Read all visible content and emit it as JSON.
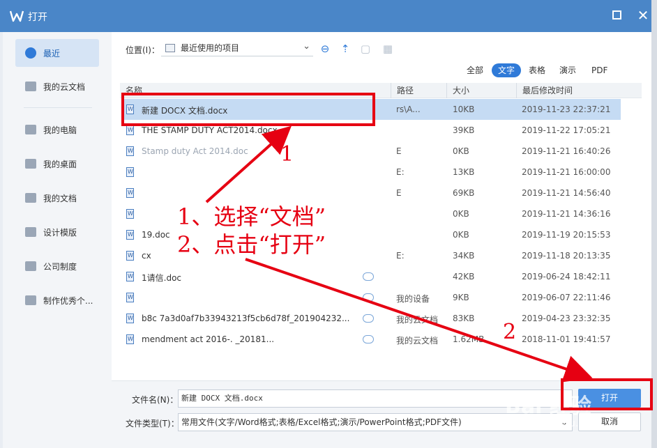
{
  "window": {
    "title": "打开"
  },
  "sidebar": {
    "items": [
      {
        "label": "最近",
        "icon": "clock-icon",
        "active": true
      },
      {
        "label": "我的云文档",
        "icon": "cloud-cube-icon"
      },
      {
        "label": "我的电脑",
        "icon": "computer-icon"
      },
      {
        "label": "我的桌面",
        "icon": "desktop-icon"
      },
      {
        "label": "我的文档",
        "icon": "folder-icon"
      },
      {
        "label": "设计模版",
        "icon": "folder-icon"
      },
      {
        "label": "公司制度",
        "icon": "folder-icon"
      },
      {
        "label": "制作优秀个...",
        "icon": "folder-icon"
      }
    ]
  },
  "toolbar": {
    "location_label": "位置(I)：",
    "location_value": "最近使用的项目"
  },
  "filters": [
    "全部",
    "文字",
    "表格",
    "演示",
    "PDF"
  ],
  "table": {
    "headers": [
      "名称",
      "路径",
      "大小",
      "最后修改时间"
    ],
    "rows": [
      {
        "name": "新建 DOCX 文档.docx",
        "path": "rs\\A...",
        "size": "10KB",
        "date": "2019-11-23 22:37:21"
      },
      {
        "name": "THE STAMP DUTY ACT2014.docx",
        "path": "",
        "size": "39KB",
        "date": "2019-11-22 17:05:21"
      },
      {
        "name": "Stamp duty Act 2014.doc",
        "path": "E",
        "size": "0KB",
        "date": "2019-11-21 16:40:26"
      },
      {
        "name": "",
        "path": "E:",
        "size": "13KB",
        "date": "2019-11-21 16:00:00"
      },
      {
        "name": "",
        "path": "E",
        "size": "69KB",
        "date": "2019-11-21 14:56:40"
      },
      {
        "name": "",
        "path": "",
        "size": "0KB",
        "date": "2019-11-21 14:36:16"
      },
      {
        "name": "19.doc",
        "path": "",
        "size": "0KB",
        "date": "2019-11-19 20:15:53"
      },
      {
        "name": "cx",
        "path": "E:",
        "size": "34KB",
        "date": "2019-11-18 20:13:35"
      },
      {
        "name": "1请信.doc",
        "path": "",
        "size": "42KB",
        "date": "2019-06-24 18:42:11"
      },
      {
        "name": "",
        "path": "我的设备",
        "size": "9KB",
        "date": "2019-06-07 22:11:46"
      },
      {
        "name": "b8c   7a3d0af7b33943213f5cb6d78f_201904232...",
        "path": "我的云文档",
        "size": "83KB",
        "date": "2019-04-23 23:32:35"
      },
      {
        "name": "mendment act 2016-.       _20181...",
        "path": "我的云文档",
        "size": "1.62MB",
        "date": "2018-11-01 19:41:57"
      }
    ]
  },
  "footer": {
    "filename_label": "文件名(N)：",
    "filename_value": "新建 DOCX 文档.docx",
    "filetype_label": "文件类型(T)：",
    "filetype_value": "常用文件(文字/Word格式;表格/Excel格式;演示/PowerPoint格式;PDF文件)",
    "open_label": "打开",
    "cancel_label": "取消"
  },
  "annotations": {
    "line1": "1、选择“文档”",
    "line2": "2、点击“打开”",
    "num1": "1",
    "num2": "2",
    "color": "#e60012"
  },
  "watermark": {
    "main": "Bai 经验",
    "sub": "jingyan.baidu.com"
  },
  "colors": {
    "titlebar": "#4a86c8",
    "accent": "#2f7ad8",
    "selected_row": "#c5dbf3"
  }
}
